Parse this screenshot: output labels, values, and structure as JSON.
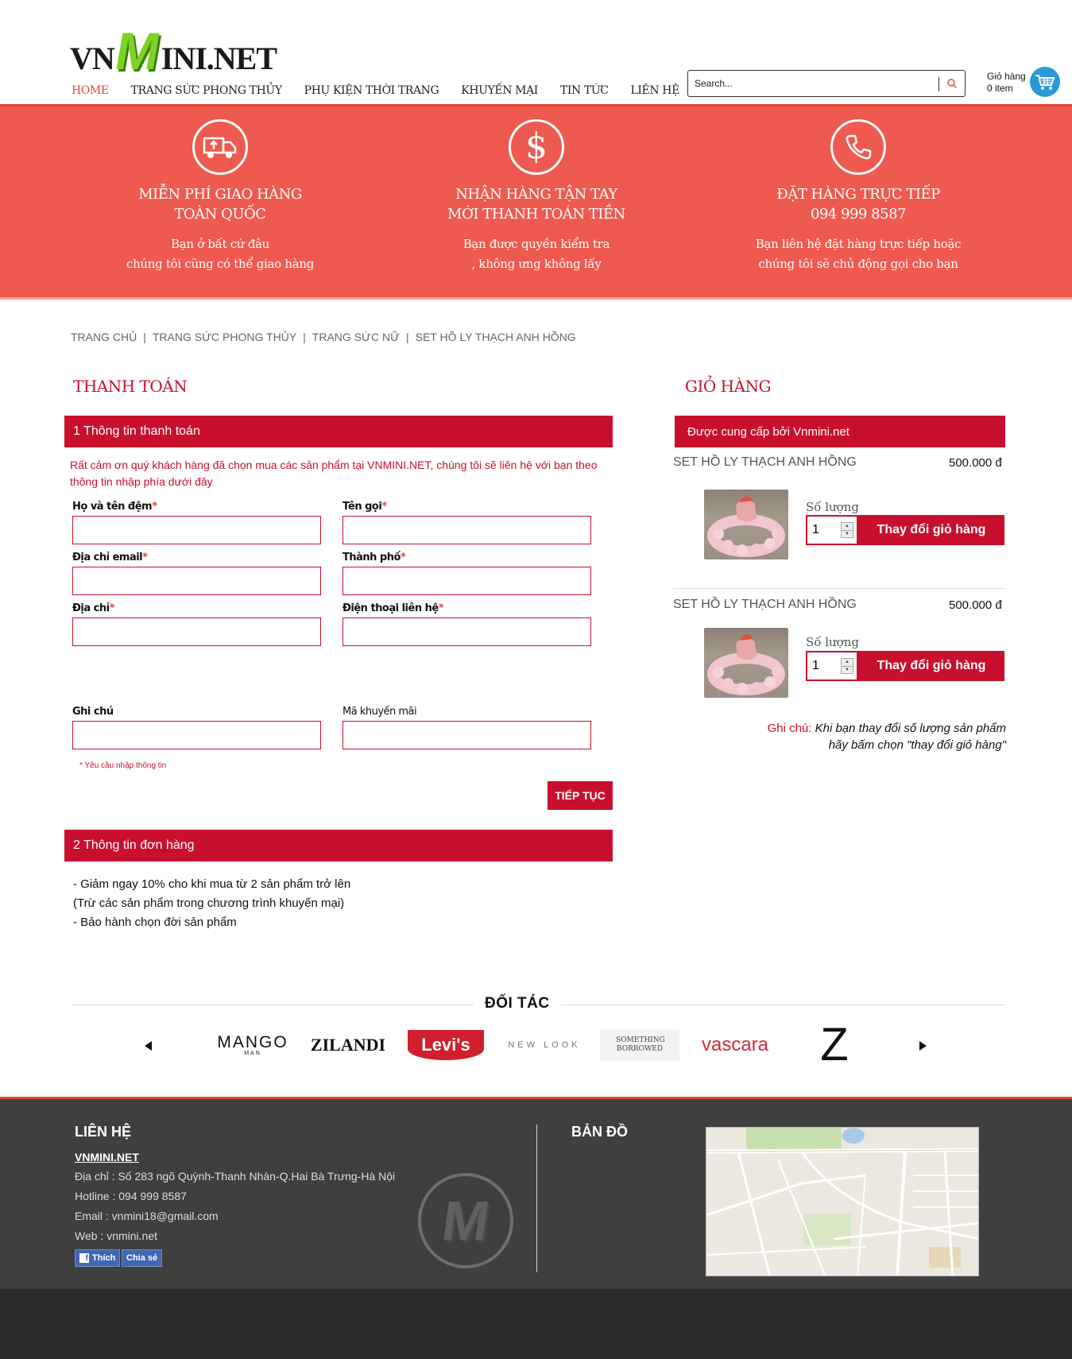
{
  "brand": {
    "logo_left": "VN",
    "logo_m": "M",
    "logo_right": "INI.NET"
  },
  "nav": [
    {
      "label": "HOME",
      "active": true
    },
    {
      "label": "TRANG SỨC PHONG THỦY"
    },
    {
      "label": "PHỤ KIỆN THỜI TRANG"
    },
    {
      "label": "KHUYẾN MẠI"
    },
    {
      "label": "TIN TỨC"
    },
    {
      "label": "LIÊN HỆ"
    }
  ],
  "search": {
    "placeholder": "Search..."
  },
  "mini_cart": {
    "label": "Giỏ hàng",
    "count": "0 item"
  },
  "features": [
    {
      "title_1": "MIỄN PHÍ GIAO HÀNG",
      "title_2": "TOÀN QUỐC",
      "desc_1": "Bạn ở bất cứ đâu",
      "desc_2": "chúng tôi cũng có thể giao hàng",
      "icon": "delivery-truck-icon"
    },
    {
      "title_1": "NHẬN HÀNG TẬN TAY",
      "title_2": "MỚI THANH TOÁN TIỀN",
      "desc_1": "Bạn được quyền kiểm tra",
      "desc_2": ", không ưng không lấy",
      "icon": "dollar-icon"
    },
    {
      "title_1": "ĐẶT HÀNG TRỰC TIẾP",
      "title_2": "094 999 8587",
      "desc_1": "Bạn liên hệ đặt hàng trực tiếp hoặc",
      "desc_2": "chúng tôi sẽ chủ động gọi cho bạn",
      "icon": "phone-icon"
    }
  ],
  "breadcrumb": [
    "TRANG CHỦ",
    "TRANG SỨC PHONG THỦY",
    "TRANG SỨC NỮ",
    "SET HỒ LY THẠCH ANH HỒNG"
  ],
  "checkout": {
    "title": "THANH TOÁN",
    "step1": "1  Thông tin thanh toán",
    "intro": "Rất cảm ơn quý khách hàng đã chọn mua các sản phẩm tại VNMINI.NET, chúng tôi sẽ liên hệ với bạn theo thông tin nhập phía dưới đây",
    "fields": {
      "last_name": "Họ và tên đệm",
      "first_name": "Tên gọi",
      "email": "Địa chỉ email",
      "city": "Thành phố",
      "address": "Địa chỉ",
      "phone": "Điện thoại liên hệ",
      "note": "Ghi chú",
      "promo": "Mã khuyến mãi"
    },
    "required_mark": "*",
    "required_note": "* Yêu cầu nhập thông tin",
    "next_button": "TIẾP TỤC",
    "step2": "2  Thông tin đơn hàng",
    "order_info": [
      "- Giảm ngay 10% cho khi mua từ 2 sản phẩm trở lên",
      "(Trừ các sản phẩm trong chương trình khuyến mại)",
      "- Bảo hành chọn đời sản phẩm"
    ]
  },
  "cart": {
    "title": "GIỎ HÀNG",
    "provider": "Được cung cấp bởi Vnmini.net",
    "items": [
      {
        "name": "SET HỒ LY THẠCH ANH HỒNG",
        "price": "500.000 đ",
        "qty_label": "Số lượng",
        "qty": "1",
        "update_button": "Thay đổi giỏ hàng"
      },
      {
        "name": "SET HỒ LY THẠCH ANH HỒNG",
        "price": "500.000 đ",
        "qty_label": "Số lượng",
        "qty": "1",
        "update_button": "Thay đổi giỏ hàng"
      }
    ],
    "note_label": "Ghi chú:",
    "note_text_1": " Khi bạn thay đổi số lượng sản phẩm",
    "note_text_2": "hãy bấm chọn \"thay đổi giỏ hàng\""
  },
  "partners": {
    "title": "ĐỐI TÁC",
    "brands": [
      "MANGO",
      "MAN",
      "ZILANDI",
      "Levi's",
      "NEW LOOK",
      "SOMETHING BORROWED",
      "vascara",
      "Z"
    ]
  },
  "footer": {
    "contact_title": "LIÊN HỆ",
    "site": "VNMINI.NET",
    "address": "Địa chỉ : Số 283 ngõ Quỳnh-Thanh Nhàn-Q.Hai Bà Trưng-Hà Nội",
    "hotline": "Hotline : 094 999 8587",
    "email": "Email : vnmini18@gmail.com",
    "web": "Web : vnmini.net",
    "like": "Thích",
    "share": "Chia sẻ",
    "map_title": "BẢN ĐỒ",
    "watermark": "M"
  },
  "colors": {
    "accent": "#c8102e",
    "banner": "#ee5a4f",
    "footer": "#3f3f3f",
    "logo_green": "#7ed321"
  }
}
